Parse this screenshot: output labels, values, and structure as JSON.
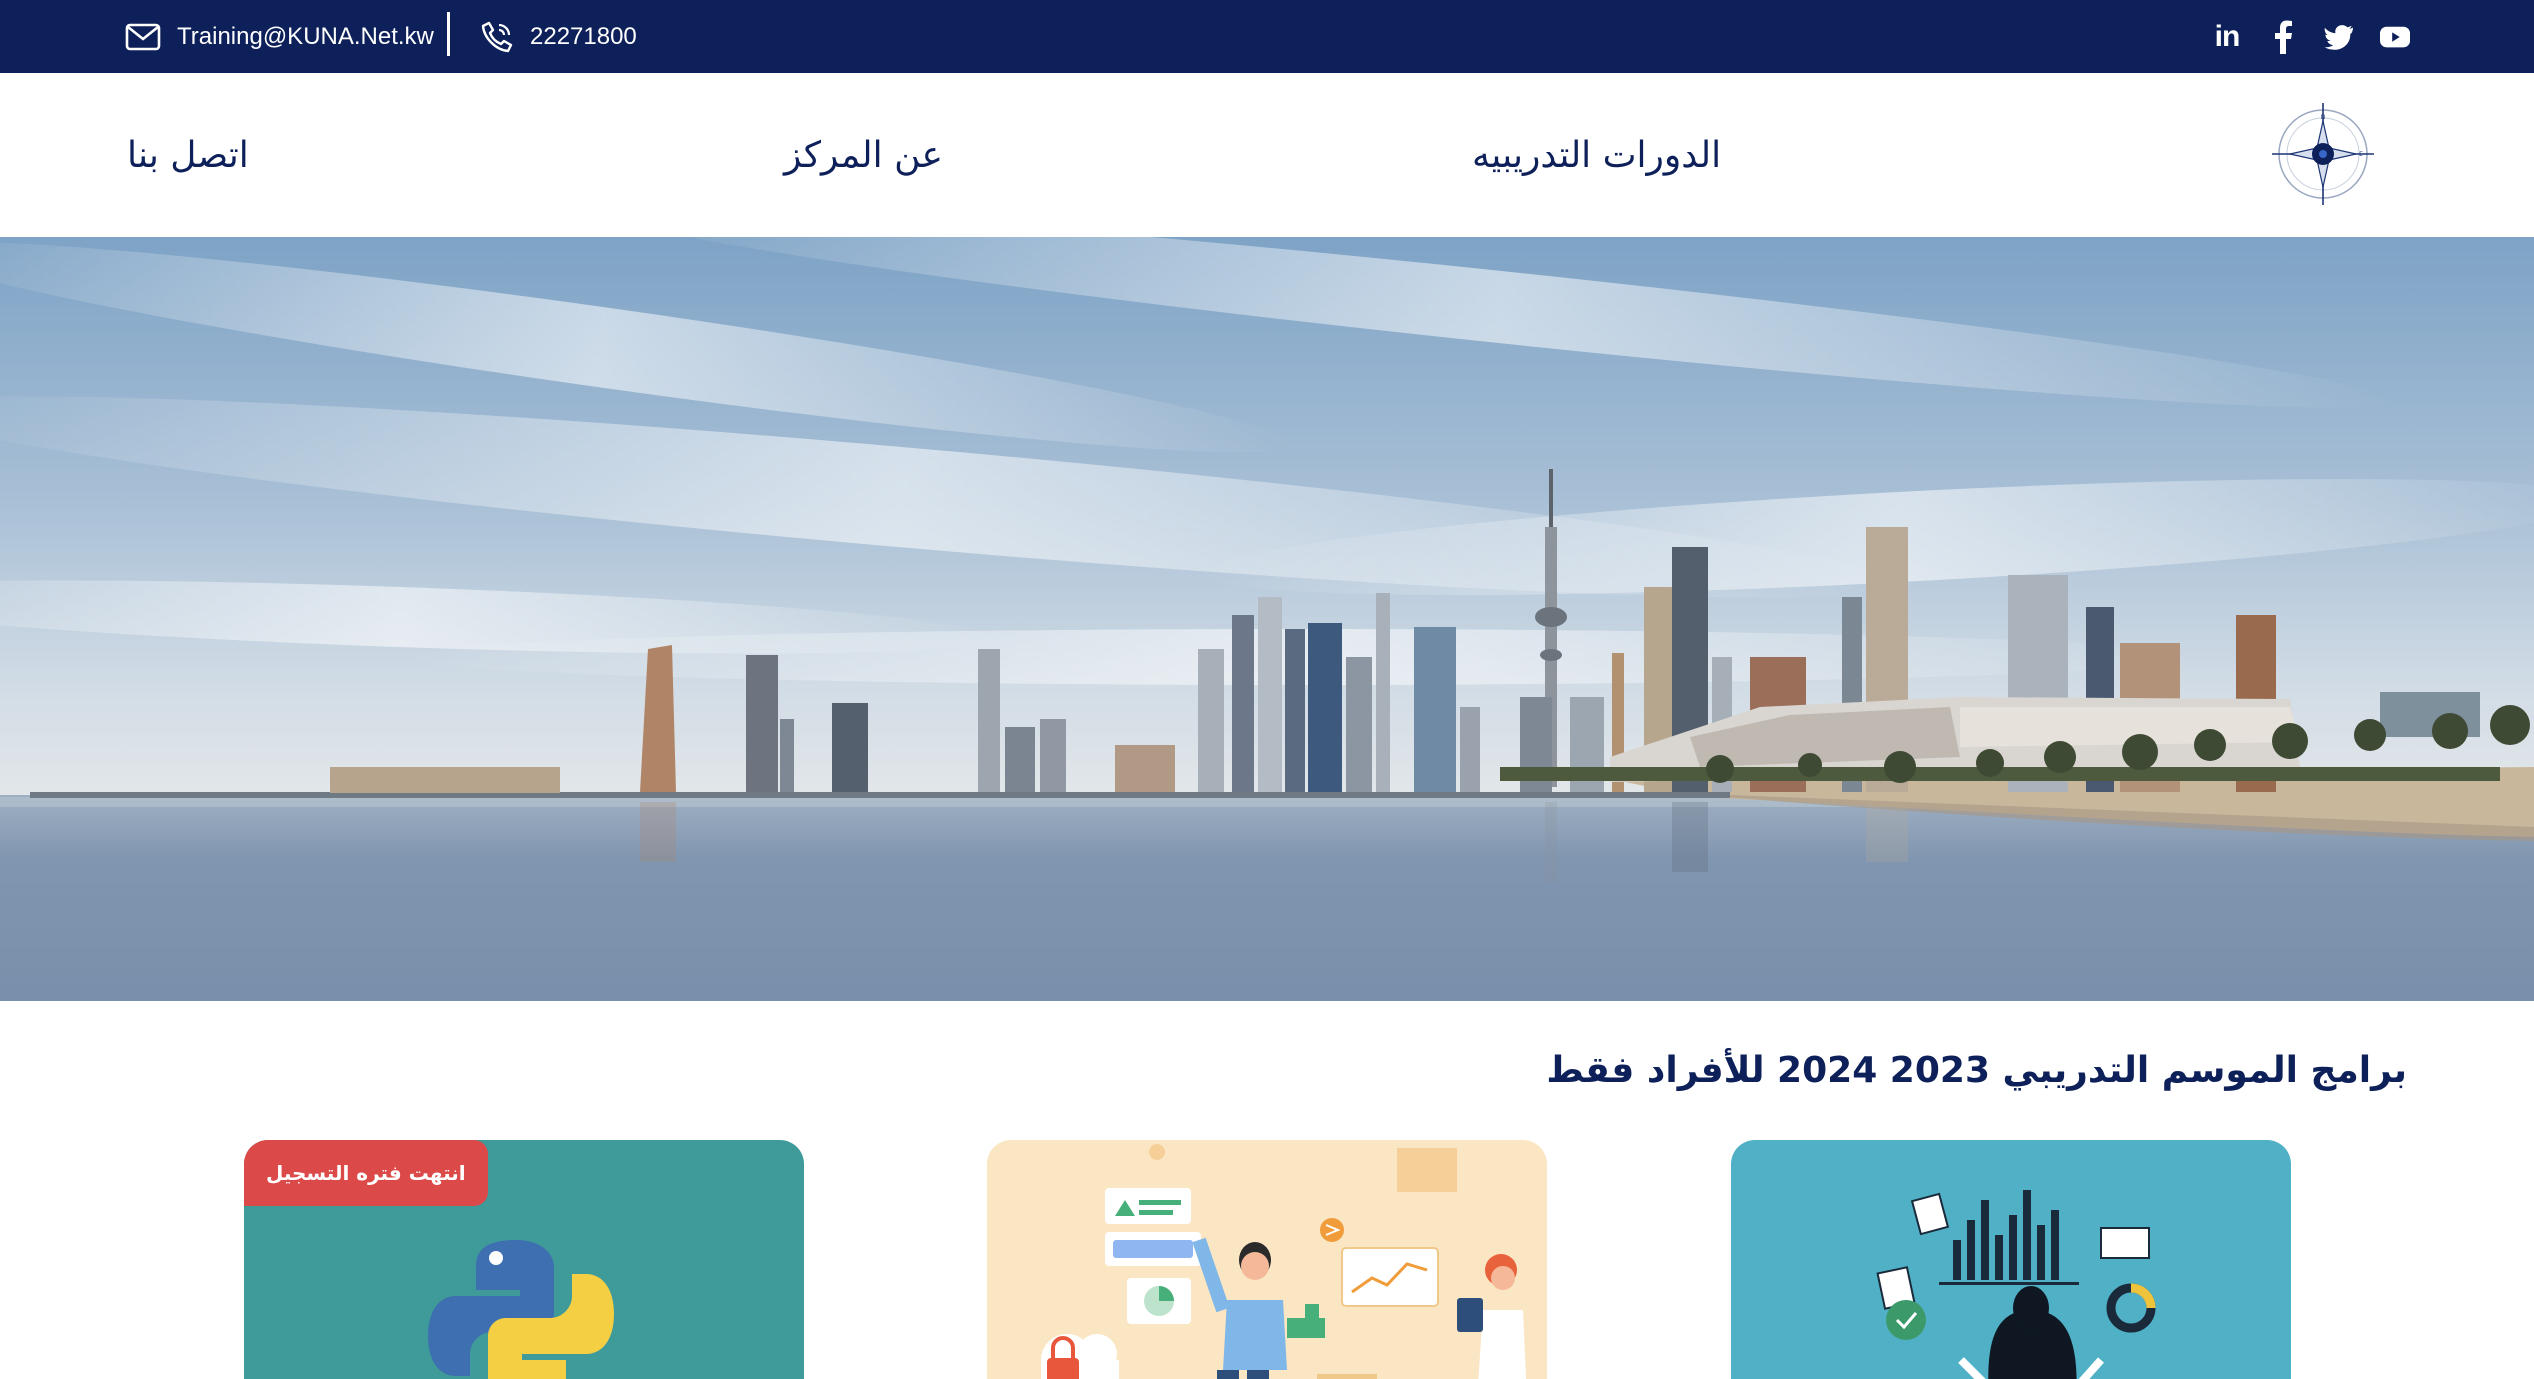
{
  "topbar": {
    "email": "Training@KUNA.Net.kw",
    "phone": "22271800",
    "social": [
      {
        "name": "linkedin",
        "label": "in"
      },
      {
        "name": "facebook",
        "label": "f"
      },
      {
        "name": "twitter",
        "label": ""
      },
      {
        "name": "youtube",
        "label": ""
      }
    ]
  },
  "nav": {
    "courses": "الدورات التدريبيه",
    "about": "عن المركز",
    "contact": "اتصل بنا"
  },
  "section": {
    "title": "برامج الموسم التدريبي 2023 2024 للأفراد فقط"
  },
  "cards": [
    {
      "theme": "data-analysis",
      "color": "#4fb0c6"
    },
    {
      "theme": "business-analytics",
      "color": "#fbe6c3"
    },
    {
      "theme": "python",
      "color": "#3f9a9a",
      "badge": "انتهت فتره التسجيل"
    }
  ],
  "colors": {
    "primary": "#0d2059",
    "badge": "#dc4949"
  }
}
